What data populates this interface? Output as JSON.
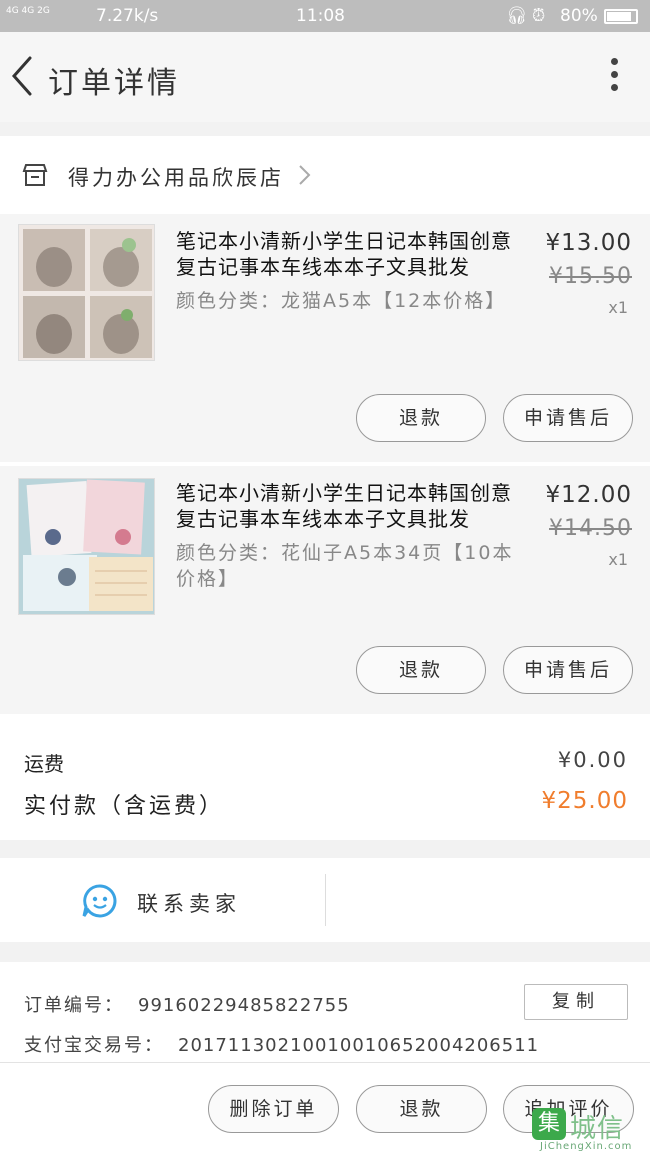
{
  "status_bar": {
    "network": "4G 4G 2G",
    "speed": "7.27k/s",
    "time": "11:08",
    "battery": "80%"
  },
  "header": {
    "title": "订单详情"
  },
  "store": {
    "name": "得力办公用品欣辰店"
  },
  "items": [
    {
      "title": "笔记本小清新小学生日记本韩国创意复古记事本车线本本子文具批发",
      "spec": "颜色分类：龙猫A5本【12本价格】",
      "price": "¥13.00",
      "original_price": "¥15.50",
      "qty": "x1",
      "btn_refund": "退款",
      "btn_aftersale": "申请售后"
    },
    {
      "title": "笔记本小清新小学生日记本韩国创意复古记事本车线本本子文具批发",
      "spec": "颜色分类：花仙子A5本34页【10本价格】",
      "price": "¥12.00",
      "original_price": "¥14.50",
      "qty": "x1",
      "btn_refund": "退款",
      "btn_aftersale": "申请售后"
    }
  ],
  "fees": {
    "shipping_label": "运费",
    "shipping_value": "¥0.00",
    "paid_label": "实付款（含运费）",
    "paid_value": "¥25.00",
    "accent_color": "#f07d2d"
  },
  "contact": {
    "label": "联系卖家"
  },
  "order_info": {
    "order_no_label": "订单编号：",
    "order_no": "99160229485822755",
    "alipay_label": "支付宝交易号：",
    "alipay_no": "20171130210010010652004206511",
    "copy_label": "复制"
  },
  "bottom_bar": {
    "delete_label": "删除订单",
    "refund_label": "退款",
    "review_label": "追加评价"
  },
  "watermark": {
    "logo": "集",
    "cn": "城信",
    "en": "JiChengXin.com"
  }
}
